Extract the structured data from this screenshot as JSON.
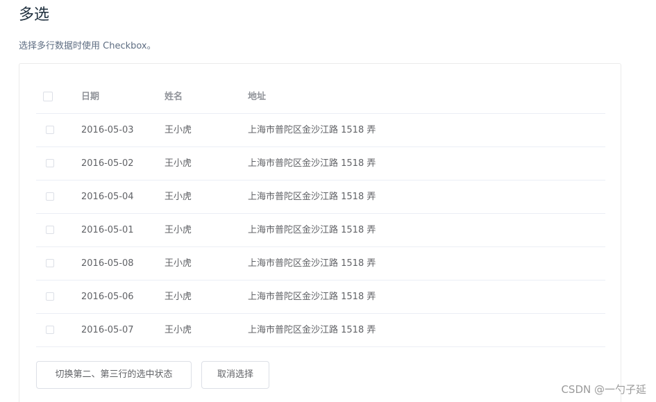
{
  "header": {
    "title": "多选",
    "description": "选择多行数据时使用 Checkbox。"
  },
  "table": {
    "columns": {
      "date": "日期",
      "name": "姓名",
      "address": "地址"
    },
    "rows": [
      {
        "date": "2016-05-03",
        "name": "王小虎",
        "address": "上海市普陀区金沙江路 1518 弄",
        "checked": false
      },
      {
        "date": "2016-05-02",
        "name": "王小虎",
        "address": "上海市普陀区金沙江路 1518 弄",
        "checked": false
      },
      {
        "date": "2016-05-04",
        "name": "王小虎",
        "address": "上海市普陀区金沙江路 1518 弄",
        "checked": false
      },
      {
        "date": "2016-05-01",
        "name": "王小虎",
        "address": "上海市普陀区金沙江路 1518 弄",
        "checked": false
      },
      {
        "date": "2016-05-08",
        "name": "王小虎",
        "address": "上海市普陀区金沙江路 1518 弄",
        "checked": false
      },
      {
        "date": "2016-05-06",
        "name": "王小虎",
        "address": "上海市普陀区金沙江路 1518 弄",
        "checked": false
      },
      {
        "date": "2016-05-07",
        "name": "王小虎",
        "address": "上海市普陀区金沙江路 1518 弄",
        "checked": false
      }
    ]
  },
  "actions": {
    "toggle_label": "切换第二、第三行的选中状态",
    "clear_label": "取消选择"
  },
  "watermark": "CSDN @一勺子延",
  "colors": {
    "border": "#ebeef5",
    "header_text": "#909399",
    "body_text": "#606266",
    "title_text": "#1f2f3d"
  }
}
